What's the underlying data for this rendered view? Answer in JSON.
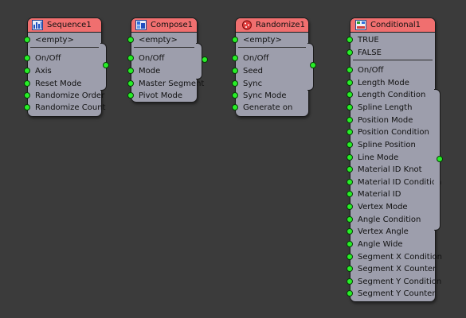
{
  "colors": {
    "background": "#3b3b3b",
    "node_body": "#9d9eac",
    "node_header": "#f06f6f",
    "port": "#27ee27"
  },
  "nodes": {
    "sequence": {
      "title": "Sequence1",
      "icon": "sequence-icon",
      "empty": "<empty>",
      "inputs": [
        "On/Off",
        "Axis",
        "Reset Mode",
        "Randomize Order",
        "Randomize Count"
      ]
    },
    "compose": {
      "title": "Compose1",
      "icon": "compose-icon",
      "empty": "<empty>",
      "inputs": [
        "On/Off",
        "Mode",
        "Master Segment",
        "Pivot Mode"
      ]
    },
    "randomize": {
      "title": "Randomize1",
      "icon": "randomize-icon",
      "empty": "<empty>",
      "inputs": [
        "On/Off",
        "Seed",
        "Sync",
        "Sync Mode",
        "Generate on"
      ]
    },
    "conditional": {
      "title": "Conditional1",
      "icon": "conditional-icon",
      "branches": [
        "TRUE",
        "FALSE"
      ],
      "inputs": [
        "On/Off",
        "Length Mode",
        "Length Condition",
        "Spline Length",
        "Position Mode",
        "Position Condition",
        "Spline Position",
        "Line Mode",
        "Material ID Knot",
        "Material ID Condition",
        "Material ID",
        "Vertex Mode",
        "Angle Condition",
        "Vertex Angle",
        "Angle Wide",
        "Segment X Condition",
        "Segment X Counter",
        "Segment Y Condition",
        "Segment Y Counter"
      ]
    }
  }
}
